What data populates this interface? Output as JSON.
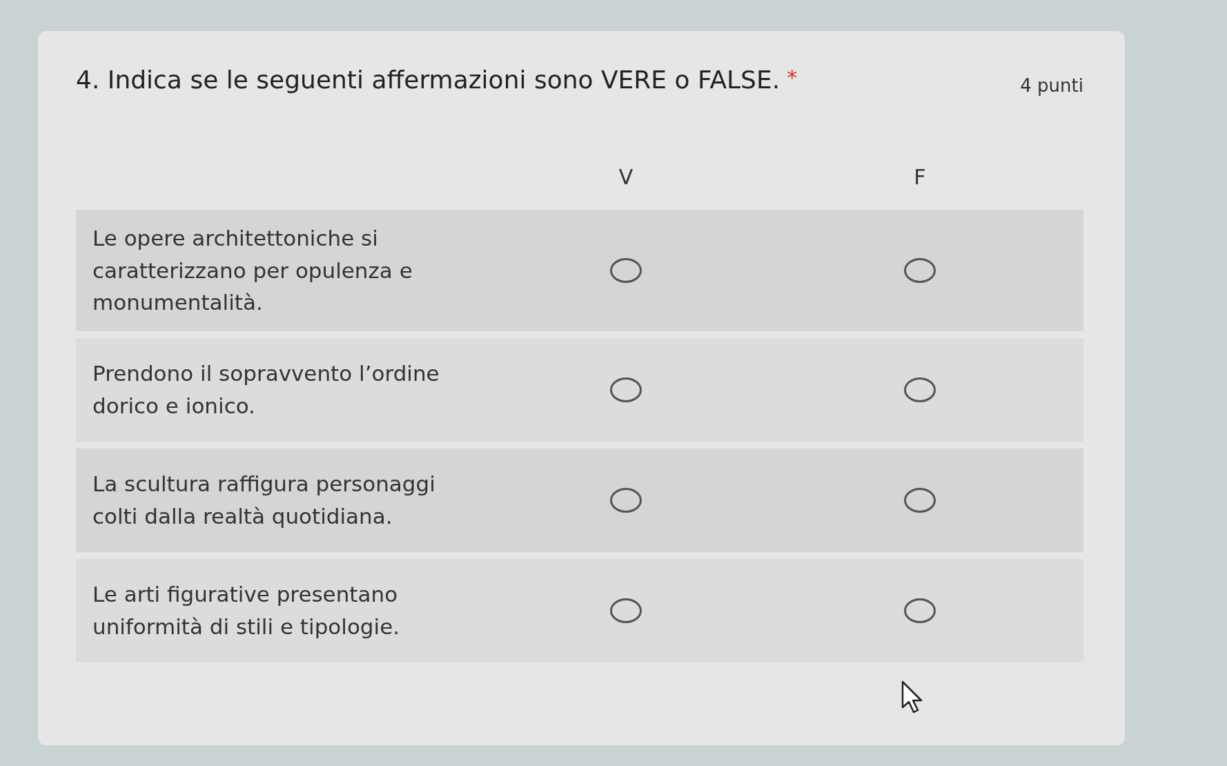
{
  "question": {
    "title": "4. Indica se le seguenti affermazioni sono VERE o FALSE.",
    "required_mark": "*",
    "points": "4 punti"
  },
  "columns": [
    "V",
    "F"
  ],
  "rows": [
    {
      "statement": "Le opere architettoniche si caratterizzano per opulenza e monumentalità.",
      "options": [
        {
          "selected": false
        },
        {
          "selected": false
        }
      ]
    },
    {
      "statement": "Prendono il sopravvento l’ordine dorico e ionico.",
      "options": [
        {
          "selected": false
        },
        {
          "selected": false
        }
      ]
    },
    {
      "statement": "La scultura raffigura personaggi colti dalla realtà quotidiana.",
      "options": [
        {
          "selected": false
        },
        {
          "selected": false
        }
      ]
    },
    {
      "statement": "Le arti figurative presentano uniformità di stili e tipologie.",
      "options": [
        {
          "selected": false
        },
        {
          "selected": false
        }
      ]
    }
  ]
}
